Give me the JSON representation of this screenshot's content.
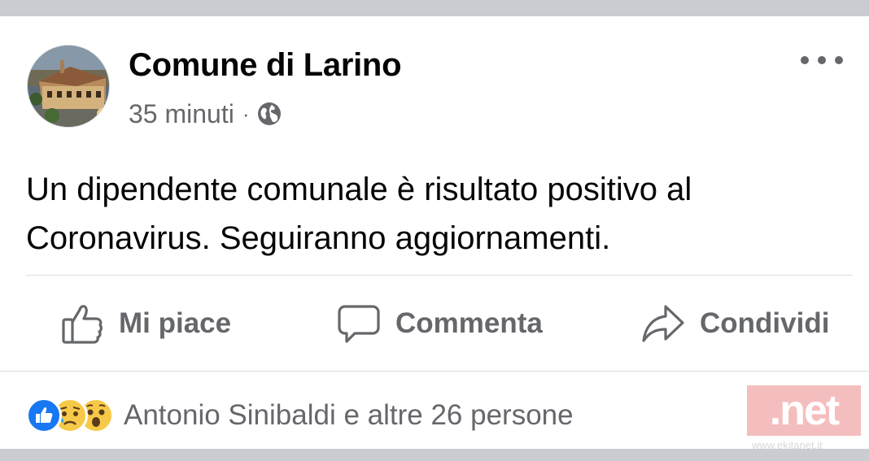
{
  "post": {
    "page_name": "Comune di Larino",
    "time": "35 minuti",
    "separator": "·",
    "audience_icon": "globe-icon",
    "more_icon": "more-options-icon",
    "text": "Un dipendente comunale è risultato positivo al Coronavirus. Seguiranno aggiornamenti."
  },
  "actions": {
    "like_label": "Mi piace",
    "like_icon": "thumbs-up-icon",
    "comment_label": "Commenta",
    "comment_icon": "comment-icon",
    "share_label": "Condividi",
    "share_icon": "share-icon"
  },
  "reactions": {
    "icons": [
      "like-reaction-icon",
      "sad-reaction-icon",
      "wow-reaction-icon"
    ],
    "summary": "Antonio Sinibaldi e altre 26 persone"
  },
  "watermark": {
    "text": ".net",
    "small_text": "www.ekitanet.it"
  },
  "colors": {
    "primary_text": "#050505",
    "secondary_text": "#65676b",
    "like_blue": "#1877f2",
    "reaction_yellow": "#f7c948",
    "separator_band": "#c9ccd1",
    "watermark_pink": "#f4b3b3"
  }
}
